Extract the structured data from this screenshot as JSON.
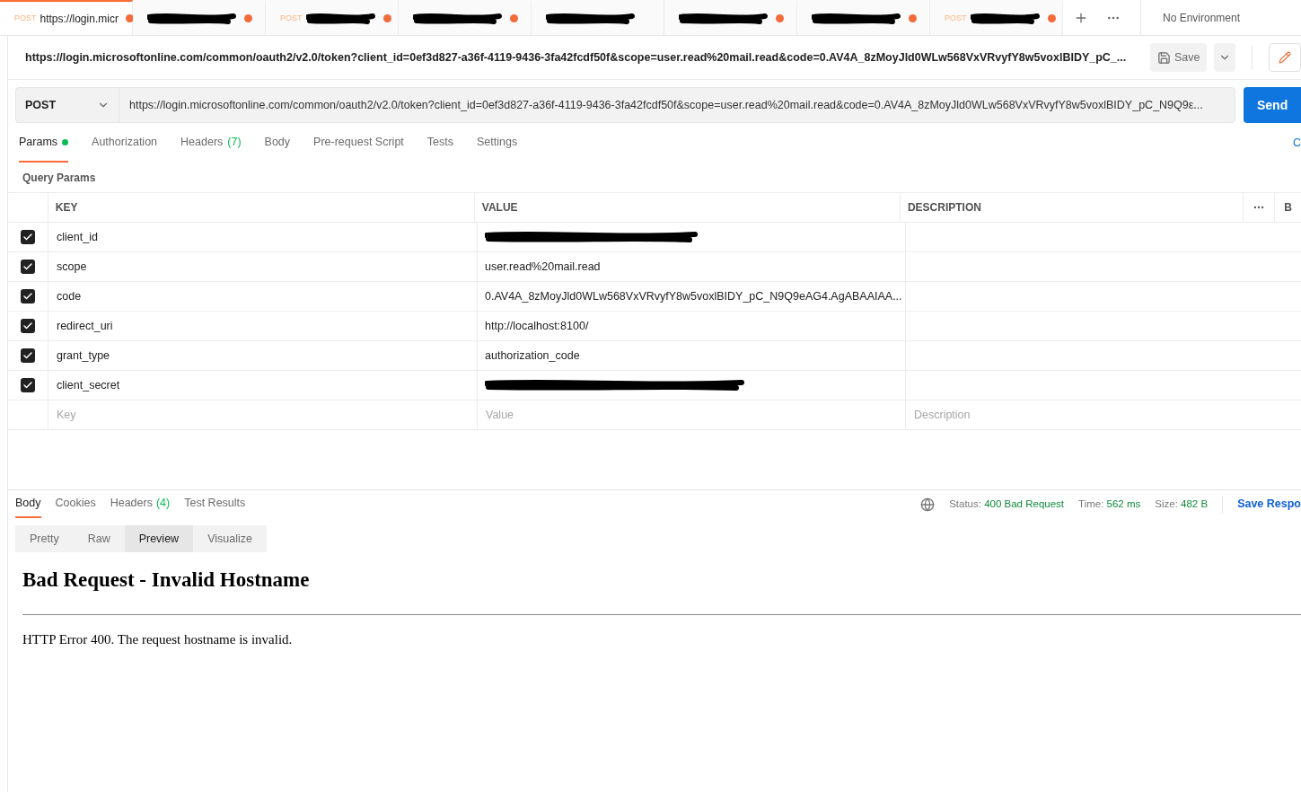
{
  "tabs": [
    {
      "method": "POST",
      "title": "https://login.micr",
      "unsaved": true,
      "selected": true,
      "redacted": false
    },
    {
      "unsaved": true,
      "selected": false,
      "redacted": true
    },
    {
      "method": "POST",
      "unsaved": true,
      "selected": false,
      "redacted": true
    },
    {
      "unsaved": true,
      "selected": false,
      "redacted": true
    },
    {
      "unsaved": false,
      "selected": false,
      "redacted": true
    },
    {
      "unsaved": true,
      "selected": false,
      "redacted": true
    },
    {
      "unsaved": true,
      "selected": false,
      "redacted": true
    },
    {
      "method": "POST",
      "unsaved": true,
      "selected": false,
      "redacted": true
    }
  ],
  "environment": "No Environment",
  "request_title": "https://login.microsoftonline.com/common/oauth2/v2.0/token?client_id=0ef3d827-a36f-4119-9436-3fa42fcdf50f&scope=user.read%20mail.read&code=0.AV4A_8zMoyJld0WLw568VxVRvyfY8w5voxlBIDY_pC_...",
  "save_label": "Save",
  "method": "POST",
  "url": "https://login.microsoftonline.com/common/oauth2/v2.0/token?client_id=0ef3d827-a36f-4119-9436-3fa42fcdf50f&scope=user.read%20mail.read&code=0.AV4A_8zMoyJld0WLw568VxVRvyfY8w5voxlBIDY_pC_N9Q9ε...",
  "send_label": "Send",
  "request_tabs": [
    {
      "label": "Params",
      "indicator": true,
      "selected": true
    },
    {
      "label": "Authorization",
      "indicator": false,
      "selected": false
    },
    {
      "label": "Headers",
      "count": "(7)",
      "indicator": false,
      "selected": false
    },
    {
      "label": "Body",
      "indicator": false,
      "selected": false
    },
    {
      "label": "Pre-request Script",
      "indicator": false,
      "selected": false
    },
    {
      "label": "Tests",
      "indicator": false,
      "selected": false
    },
    {
      "label": "Settings",
      "indicator": false,
      "selected": false
    }
  ],
  "cookies_link": "C",
  "section_title": "Query Params",
  "columns": [
    "KEY",
    "VALUE",
    "DESCRIPTION",
    "B"
  ],
  "params": [
    {
      "key": "client_id",
      "value_redacted": true,
      "checked": true
    },
    {
      "key": "scope",
      "value": "user.read%20mail.read",
      "value_redacted": false,
      "checked": true
    },
    {
      "key": "code",
      "value": "0.AV4A_8zMoyJld0WLw568VxVRvyfY8w5voxlBIDY_pC_N9Q9eAG4.AgABAAIAA...",
      "value_redacted": false,
      "checked": true
    },
    {
      "key": "redirect_uri",
      "value": "http://localhost:8100/",
      "value_redacted": false,
      "checked": true
    },
    {
      "key": "grant_type",
      "value": "authorization_code",
      "value_redacted": false,
      "checked": true
    },
    {
      "key": "client_secret",
      "value_redacted": true,
      "checked": true
    }
  ],
  "new_row": {
    "key_placeholder": "Key",
    "value_placeholder": "Value",
    "description_placeholder": "Description"
  },
  "response_tabs": [
    {
      "label": "Body",
      "selected": true
    },
    {
      "label": "Cookies",
      "selected": false
    },
    {
      "label": "Headers",
      "count": "(4)",
      "selected": false
    },
    {
      "label": "Test Results",
      "selected": false
    }
  ],
  "status": {
    "status_label": "Status:",
    "status_value": "400 Bad Request",
    "time_label": "Time:",
    "time_value": "562 ms",
    "size_label": "Size:",
    "size_value": "482 B"
  },
  "save_response": "Save Respo",
  "view_modes": [
    {
      "label": "Pretty",
      "selected": false
    },
    {
      "label": "Raw",
      "selected": false
    },
    {
      "label": "Preview",
      "selected": true
    },
    {
      "label": "Visualize",
      "selected": false
    }
  ],
  "preview": {
    "heading": "Bad Request - Invalid Hostname",
    "message": "HTTP Error 400. The request hostname is invalid."
  }
}
